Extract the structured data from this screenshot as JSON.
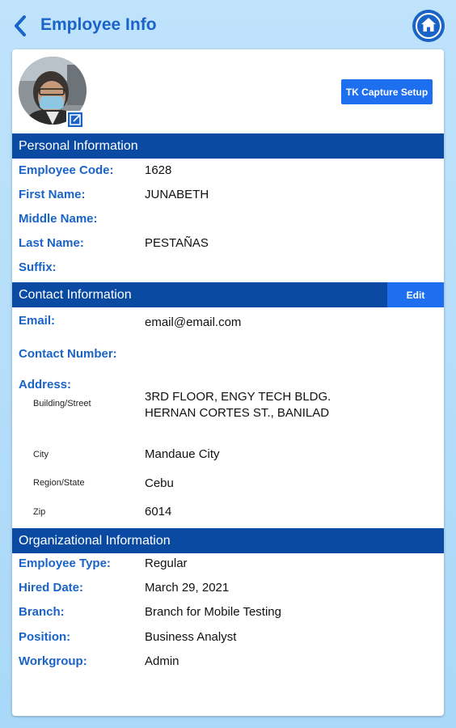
{
  "header": {
    "title": "Employee Info"
  },
  "icons": {
    "back": "back-arrow-icon",
    "home": "home-icon",
    "edit_photo": "edit-icon"
  },
  "colors": {
    "accent": "#1a63c7",
    "section_header": "#0a4aa3",
    "button": "#1e6ff0"
  },
  "profile": {
    "tk_button": "TK Capture Setup"
  },
  "personal": {
    "header": "Personal Information",
    "fields": [
      {
        "label": "Employee Code:",
        "value": "1628"
      },
      {
        "label": "First Name:",
        "value": "JUNABETH"
      },
      {
        "label": "Middle Name:",
        "value": ""
      },
      {
        "label": "Last Name:",
        "value": "PESTAÑAS"
      },
      {
        "label": "Suffix:",
        "value": ""
      }
    ]
  },
  "contact": {
    "header": "Contact Information",
    "edit_label": "Edit",
    "email_label": "Email:",
    "email_value": "email@email.com",
    "contact_label": "Contact Number:",
    "contact_value": "",
    "address_label": "Address:",
    "address": [
      {
        "label": "Building/Street",
        "value_line1": "3RD FLOOR, ENGY TECH BLDG.",
        "value_line2": "HERNAN CORTES ST., BANILAD"
      },
      {
        "label": "City",
        "value": "Mandaue City"
      },
      {
        "label": "Region/State",
        "value": "Cebu"
      },
      {
        "label": "Zip",
        "value": "6014"
      }
    ]
  },
  "organizational": {
    "header": "Organizational Information",
    "fields": [
      {
        "label": "Employee Type:",
        "value": "Regular"
      },
      {
        "label": "Hired Date:",
        "value": "March 29, 2021"
      },
      {
        "label": "Branch:",
        "value": "Branch for Mobile Testing"
      },
      {
        "label": "Position:",
        "value": "Business Analyst"
      },
      {
        "label": "Workgroup:",
        "value": "Admin"
      }
    ]
  }
}
